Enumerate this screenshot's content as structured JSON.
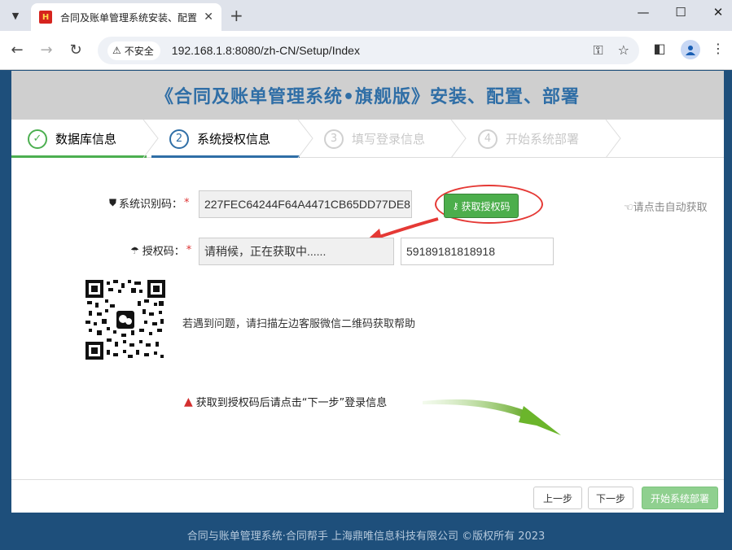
{
  "browser": {
    "tab_title": "合同及账单管理系统安装、配置",
    "favicon_text": "H",
    "insecure_label": "不安全",
    "url": "192.168.1.8:8080/zh-CN/Setup/Index"
  },
  "banner": {
    "title": "《合同及账单管理系统•旗舰版》安装、配置、部署"
  },
  "steps": [
    {
      "num": "✓",
      "label": "数据库信息"
    },
    {
      "num": "2",
      "label": "系统授权信息"
    },
    {
      "num": "3",
      "label": "填写登录信息"
    },
    {
      "num": "4",
      "label": "开始系统部署"
    }
  ],
  "form": {
    "sysid_label": "系统识别码：",
    "sysid_value": "227FEC64244F64A4471CB65DD77DE8",
    "get_button": "获取授权码",
    "auto_hint": "请点击自动获取",
    "auth_label": "授权码：",
    "auth_value": "请稍候，正在获取中......",
    "auth_extra_value": "59189181818918",
    "required_mark": "*"
  },
  "help": {
    "qr_text": "若遇到问题，请扫描左边客服微信二维码获取帮助"
  },
  "notice": {
    "text": "获取到授权码后请点击“下一步”登录信息"
  },
  "buttons": {
    "prev": "上一步",
    "next": "下一步",
    "deploy": "开始系统部署"
  },
  "footer": {
    "copyright": "合同与账单管理系统·合同帮手  上海鼎唯信息科技有限公司 ©版权所有 2023"
  },
  "colors": {
    "accent_blue": "#2f6ea6",
    "green": "#4cae4c",
    "red": "#e53935",
    "footer_bg": "#1e4f7b"
  }
}
